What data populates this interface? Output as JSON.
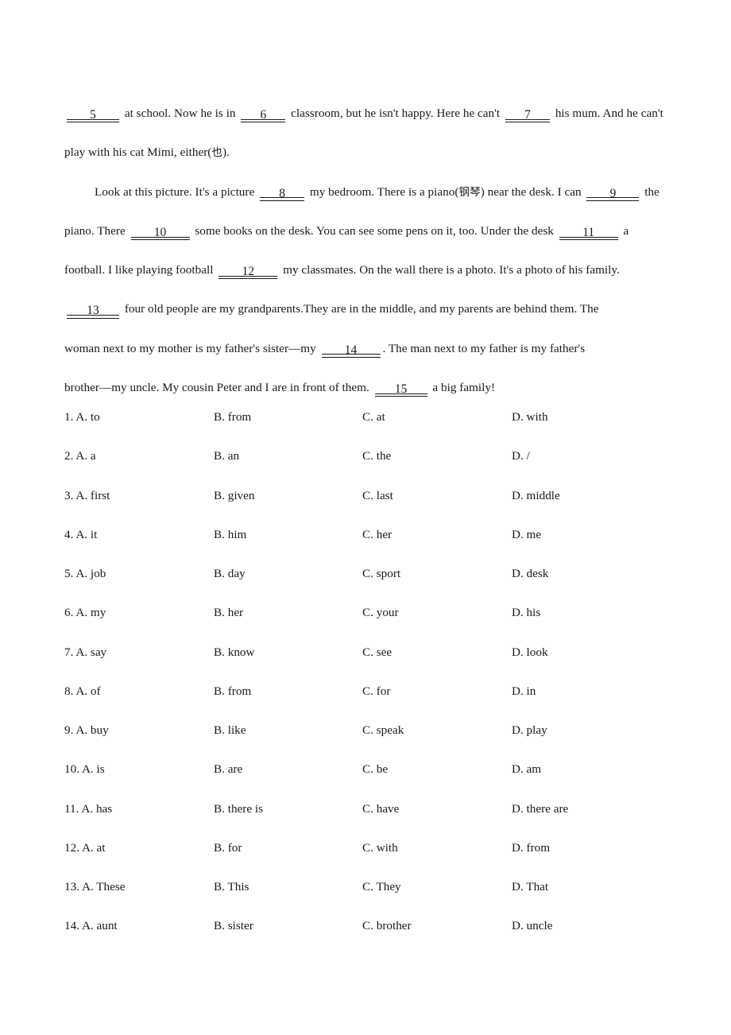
{
  "document": {
    "type": "cloze-test-worksheet",
    "language": "English with Chinese glosses"
  },
  "passage": {
    "lines": [
      {
        "indent": false,
        "parts": [
          {
            "t": "blank",
            "num": "5",
            "w": "w2"
          },
          {
            "t": "text",
            "v": " at school. Now he is in "
          },
          {
            "t": "blank",
            "num": "6",
            "w": "w1"
          },
          {
            "t": "text",
            "v": " classroom, but he isn't happy. Here he can't "
          },
          {
            "t": "blank",
            "num": "7",
            "w": "w1"
          },
          {
            "t": "text",
            "v": " his mum. And he can't"
          }
        ]
      },
      {
        "indent": false,
        "parts": [
          {
            "t": "text",
            "v": "play with his cat Mimi, either("
          },
          {
            "t": "cjk",
            "v": "也"
          },
          {
            "t": "text",
            "v": ")."
          }
        ]
      },
      {
        "indent": true,
        "parts": [
          {
            "t": "text",
            "v": "Look at this picture. It's a picture "
          },
          {
            "t": "blank",
            "num": "8",
            "w": "w1"
          },
          {
            "t": "text",
            "v": " my bedroom. There is a piano("
          },
          {
            "t": "cjk",
            "v": "钢琴"
          },
          {
            "t": "text",
            "v": ") near the desk. I can "
          },
          {
            "t": "blank",
            "num": "9",
            "w": "w2"
          },
          {
            "t": "text",
            "v": " the"
          }
        ]
      },
      {
        "indent": false,
        "parts": [
          {
            "t": "text",
            "v": "piano. There "
          },
          {
            "t": "blank",
            "num": "10",
            "w": "w3"
          },
          {
            "t": "text",
            "v": " some books on the desk. You can see some pens on it, too. Under the desk "
          },
          {
            "t": "blank",
            "num": "11",
            "w": "w3"
          },
          {
            "t": "text",
            "v": " a"
          }
        ]
      },
      {
        "indent": false,
        "parts": [
          {
            "t": "text",
            "v": "football. I like playing football "
          },
          {
            "t": "blank",
            "num": "12",
            "w": "w3"
          },
          {
            "t": "text",
            "v": " my classmates. On the wall there is a photo. It's a photo of his family."
          }
        ]
      },
      {
        "indent": false,
        "parts": [
          {
            "t": "blank",
            "num": "13",
            "w": "w2"
          },
          {
            "t": "text",
            "v": " four old people are my grandparents.They are in the middle, and my parents are behind them. The"
          }
        ]
      },
      {
        "indent": false,
        "parts": [
          {
            "t": "text",
            "v": "woman next to my mother is my father's sister—my "
          },
          {
            "t": "blank",
            "num": "14",
            "w": "w3"
          },
          {
            "t": "text",
            "v": ". The man next to my father is my father's"
          }
        ]
      },
      {
        "indent": false,
        "parts": [
          {
            "t": "text",
            "v": "brother—my uncle. My cousin Peter and I are in front of them. "
          },
          {
            "t": "blank",
            "num": "15",
            "w": "w2"
          },
          {
            "t": "text",
            "v": " a big family!"
          }
        ]
      }
    ]
  },
  "questions": [
    {
      "number": "1",
      "a": "1. A. to",
      "b": "B. from",
      "c": "C. at",
      "d": "D. with"
    },
    {
      "number": "2",
      "a": "2. A. a",
      "b": "B. an",
      "c": "C. the",
      "d": "D. /"
    },
    {
      "number": "3",
      "a": "3. A. first",
      "b": "B. given",
      "c": "C. last",
      "d": "D. middle"
    },
    {
      "number": "4",
      "a": "4. A. it",
      "b": "B. him",
      "c": "C. her",
      "d": "D. me"
    },
    {
      "number": "5",
      "a": "5. A. job",
      "b": "B. day",
      "c": "C. sport",
      "d": "D. desk"
    },
    {
      "number": "6",
      "a": "6. A. my",
      "b": "B. her",
      "c": "C. your",
      "d": "D. his"
    },
    {
      "number": "7",
      "a": "7. A. say",
      "b": "B. know",
      "c": "C. see",
      "d": "D. look"
    },
    {
      "number": "8",
      "a": "8. A. of",
      "b": "B. from",
      "c": "C. for",
      "d": "D. in"
    },
    {
      "number": "9",
      "a": "9. A. buy",
      "b": "B. like",
      "c": "C. speak",
      "d": "D. play"
    },
    {
      "number": "10",
      "a": "10. A. is",
      "b": "B. are",
      "c": "C. be",
      "d": "D. am"
    },
    {
      "number": "11",
      "a": "11. A. has",
      "b": "B. there is",
      "c": "C. have",
      "d": "D. there are"
    },
    {
      "number": "12",
      "a": "12. A. at",
      "b": "B. for",
      "c": "C. with",
      "d": "D. from"
    },
    {
      "number": "13",
      "a": "13. A. These",
      "b": "B. This",
      "c": "C. They",
      "d": "D. That"
    },
    {
      "number": "14",
      "a": "14. A. aunt",
      "b": "B. sister",
      "c": "C. brother",
      "d": "D. uncle"
    }
  ]
}
